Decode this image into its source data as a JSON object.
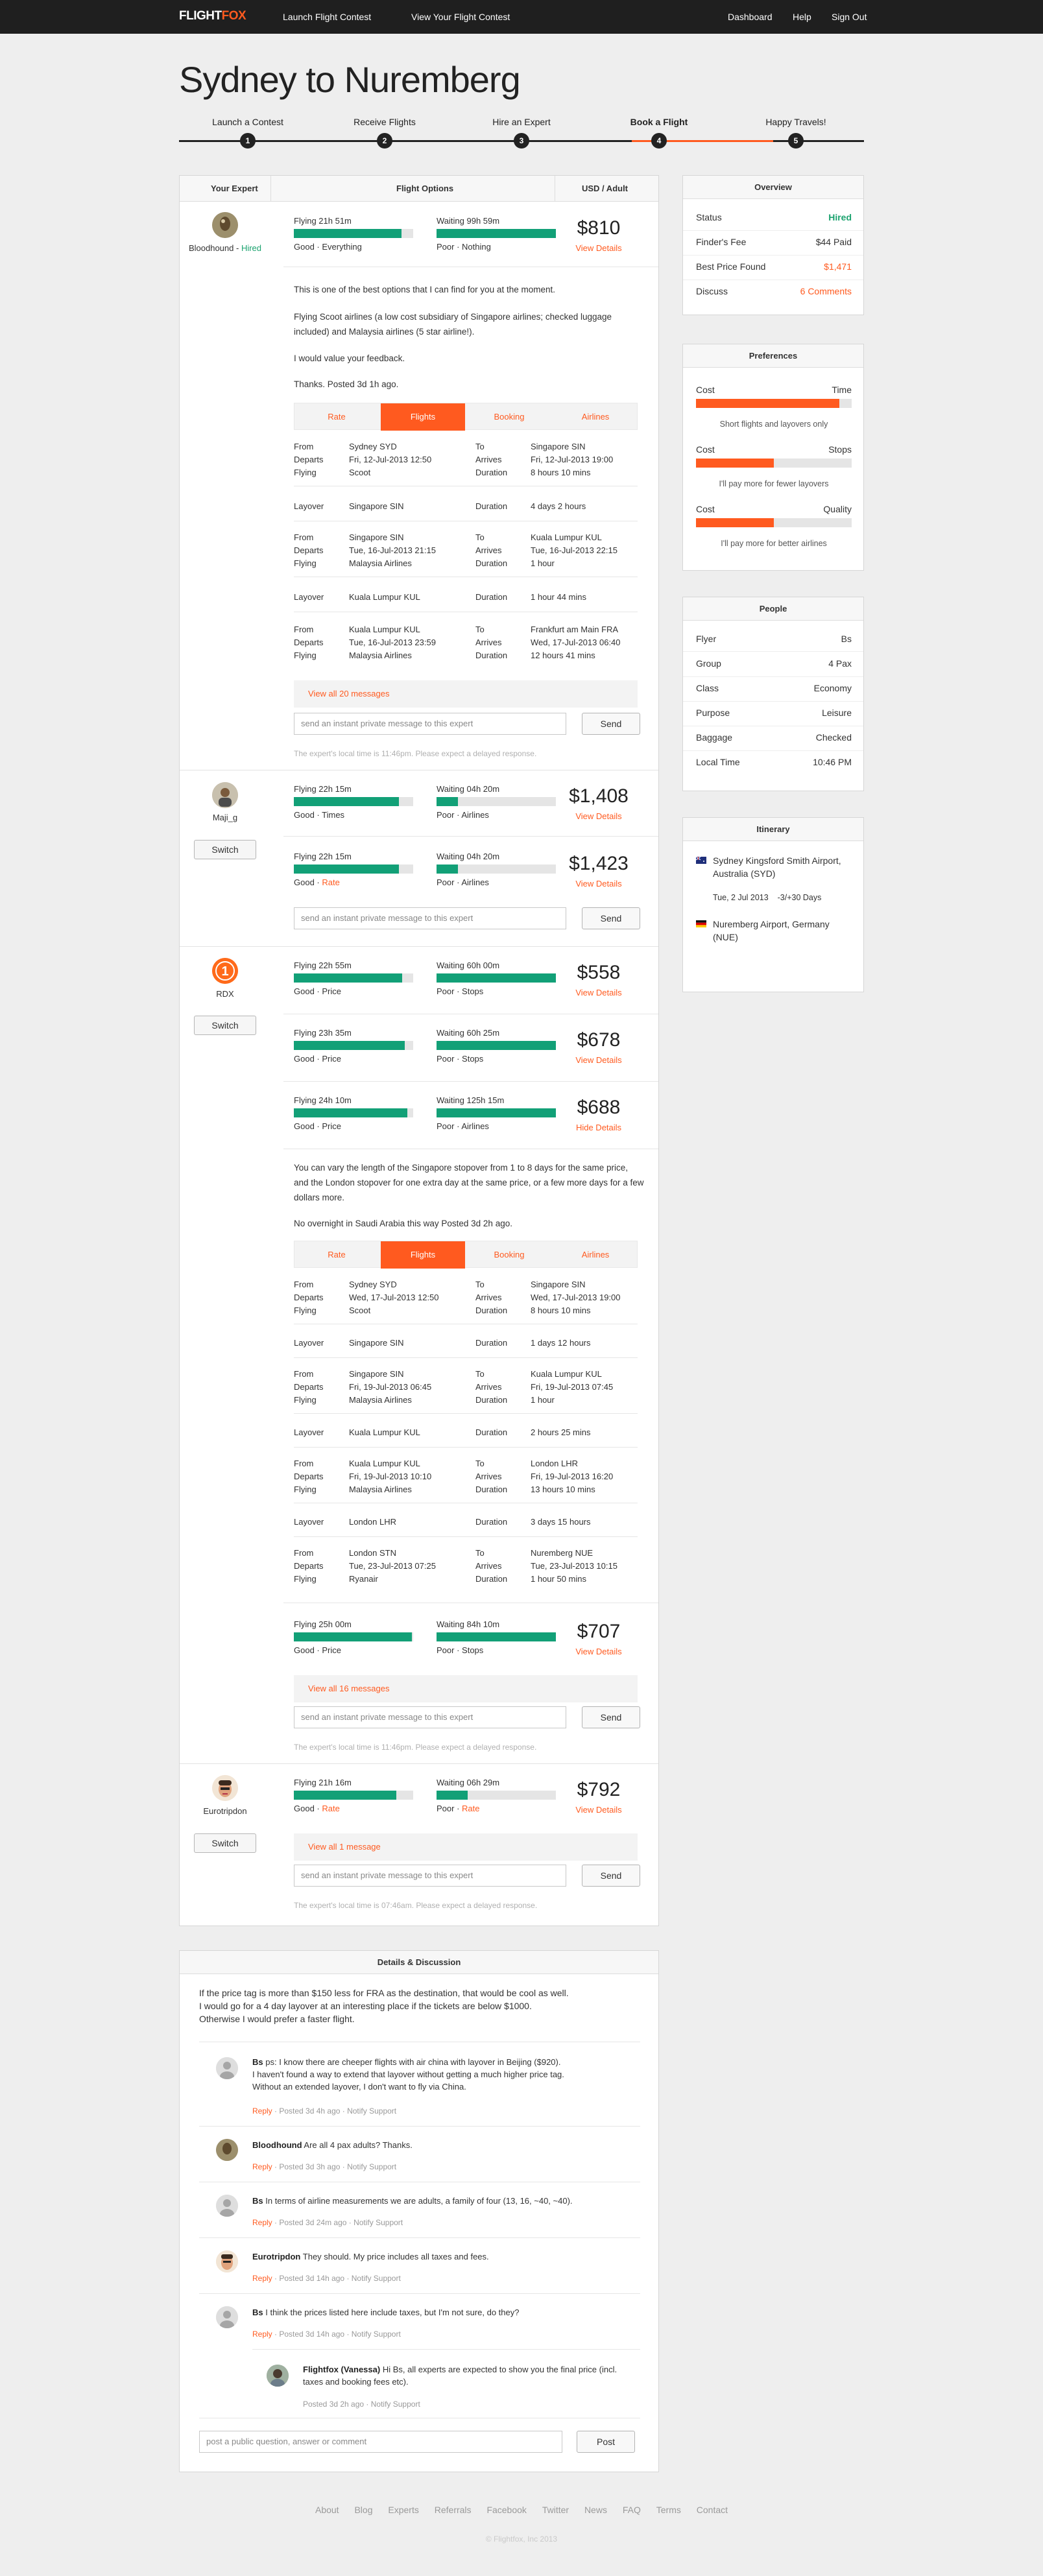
{
  "topbar": {
    "logo_a": "FLIGHT",
    "logo_b": "FOX",
    "nav_left": [
      "Launch Flight Contest",
      "View Your Flight Contest"
    ],
    "nav_right": [
      "Dashboard",
      "Help",
      "Sign Out"
    ]
  },
  "title": "Sydney to Nuremberg",
  "steps": [
    {
      "label": "Launch a Contest",
      "num": "1"
    },
    {
      "label": "Receive Flights",
      "num": "2"
    },
    {
      "label": "Hire an Expert",
      "num": "3"
    },
    {
      "label": "Book a Flight",
      "num": "4"
    },
    {
      "label": "Happy Travels!",
      "num": "5"
    }
  ],
  "main_header": {
    "expert": "Your Expert",
    "options": "Flight Options",
    "price": "USD / Adult"
  },
  "experts": {
    "e1": {
      "name": "Bloodhound",
      "sep": " - ",
      "status": "Hired",
      "options": [
        {
          "flying": "Flying 21h 51m",
          "flying_pct": 0.9,
          "waiting": "Waiting 99h 59m",
          "waiting_pct": 1.0,
          "fq": "Good",
          "fqv": "Everything",
          "wq": "Poor",
          "wqv": "Nothing",
          "price": "$810",
          "link": "View Details"
        }
      ],
      "notes": [
        "This is one of the best options that I can find for you at the moment.",
        "Flying Scoot airlines (a low cost subsidiary of Singapore airlines; checked luggage included) and Malaysia airlines (5 star airline!).",
        "I would value your feedback.",
        "Thanks. Posted 3d 1h ago."
      ],
      "tabs": [
        "Rate",
        "Flights",
        "Booking",
        "Airlines"
      ],
      "segments": [
        {
          "k1": "From",
          "v1": "Sydney SYD",
          "k2": "To",
          "v2": "Singapore SIN",
          "k3": "Departs",
          "v3": "Fri, 12-Jul-2013 12:50",
          "k4": "Arrives",
          "v4": "Fri, 12-Jul-2013 19:00",
          "k5": "Flying",
          "v5": "Scoot",
          "k6": "Duration",
          "v6": "8 hours 10 mins"
        },
        {
          "k1": "Layover",
          "v1": "Singapore SIN",
          "k2": "Duration",
          "v2": "4 days 2 hours"
        },
        {
          "k1": "From",
          "v1": "Singapore SIN",
          "k2": "To",
          "v2": "Kuala Lumpur KUL",
          "k3": "Departs",
          "v3": "Tue, 16-Jul-2013 21:15",
          "k4": "Arrives",
          "v4": "Tue, 16-Jul-2013 22:15",
          "k5": "Flying",
          "v5": "Malaysia Airlines",
          "k6": "Duration",
          "v6": "1 hour"
        },
        {
          "k1": "Layover",
          "v1": "Kuala Lumpur KUL",
          "k2": "Duration",
          "v2": "1 hour 44 mins"
        },
        {
          "k1": "From",
          "v1": "Kuala Lumpur KUL",
          "k2": "To",
          "v2": "Frankfurt am Main FRA",
          "k3": "Departs",
          "v3": "Tue, 16-Jul-2013 23:59",
          "k4": "Arrives",
          "v4": "Wed, 17-Jul-2013 06:40",
          "k5": "Flying",
          "v5": "Malaysia Airlines",
          "k6": "Duration",
          "v6": "12 hours 41 mins"
        }
      ],
      "view_all": "View all 20 messages",
      "input_placeholder": "send an instant private message to this expert",
      "send": "Send",
      "local_time": "The expert's local time is 11:46pm. Please expect a delayed response."
    },
    "e2": {
      "name": "Maji_g",
      "switch": "Switch",
      "options": [
        {
          "flying": "Flying 22h 15m",
          "flying_pct": 0.88,
          "waiting": "Waiting 04h 20m",
          "waiting_pct": 0.18,
          "fq": "Good",
          "fqv": "Times",
          "wq": "Poor",
          "wqv": "Airlines",
          "price": "$1,408",
          "link": "View Details"
        },
        {
          "flying": "Flying 22h 15m",
          "flying_pct": 0.88,
          "waiting": "Waiting 04h 20m",
          "waiting_pct": 0.18,
          "fq": "Good",
          "fqv": "Rate",
          "wq": "Poor",
          "wqv": "Airlines",
          "price": "$1,423",
          "link": "View Details"
        }
      ],
      "input_placeholder": "send an instant private message to this expert",
      "send": "Send"
    },
    "e3": {
      "name": "RDX",
      "badge": "1",
      "switch": "Switch",
      "options": [
        {
          "flying": "Flying 22h 55m",
          "flying_pct": 0.91,
          "waiting": "Waiting 60h 00m",
          "waiting_pct": 1.0,
          "fq": "Good",
          "fqv": "Price",
          "wq": "Poor",
          "wqv": "Stops",
          "price": "$558",
          "link": "View Details"
        },
        {
          "flying": "Flying 23h 35m",
          "flying_pct": 0.93,
          "waiting": "Waiting 60h 25m",
          "waiting_pct": 1.0,
          "fq": "Good",
          "fqv": "Price",
          "wq": "Poor",
          "wqv": "Stops",
          "price": "$678",
          "link": "View Details"
        },
        {
          "flying": "Flying 24h 10m",
          "flying_pct": 0.95,
          "waiting": "Waiting 125h 15m",
          "waiting_pct": 1.0,
          "fq": "Good",
          "fqv": "Price",
          "wq": "Poor",
          "wqv": "Airlines",
          "price": "$688",
          "link": "Hide Details"
        }
      ],
      "notes": [
        "You can vary the length of the Singapore stopover from 1 to 8 days for the same price, and the London stopover for one extra day at the same price, or a few more days for a few dollars more.",
        "No overnight in Saudi Arabia this way Posted 3d 2h ago."
      ],
      "tabs": [
        "Rate",
        "Flights",
        "Booking",
        "Airlines"
      ],
      "segments": [
        {
          "k1": "From",
          "v1": "Sydney SYD",
          "k2": "To",
          "v2": "Singapore SIN",
          "k3": "Departs",
          "v3": "Wed, 17-Jul-2013 12:50",
          "k4": "Arrives",
          "v4": "Wed, 17-Jul-2013 19:00",
          "k5": "Flying",
          "v5": "Scoot",
          "k6": "Duration",
          "v6": "8 hours 10 mins"
        },
        {
          "k1": "Layover",
          "v1": "Singapore SIN",
          "k2": "Duration",
          "v2": "1 days 12 hours"
        },
        {
          "k1": "From",
          "v1": "Singapore SIN",
          "k2": "To",
          "v2": "Kuala Lumpur KUL",
          "k3": "Departs",
          "v3": "Fri, 19-Jul-2013 06:45",
          "k4": "Arrives",
          "v4": "Fri, 19-Jul-2013 07:45",
          "k5": "Flying",
          "v5": "Malaysia Airlines",
          "k6": "Duration",
          "v6": "1 hour"
        },
        {
          "k1": "Layover",
          "v1": "Kuala Lumpur KUL",
          "k2": "Duration",
          "v2": "2 hours 25 mins"
        },
        {
          "k1": "From",
          "v1": "Kuala Lumpur KUL",
          "k2": "To",
          "v2": "London LHR",
          "k3": "Departs",
          "v3": "Fri, 19-Jul-2013 10:10",
          "k4": "Arrives",
          "v4": "Fri, 19-Jul-2013 16:20",
          "k5": "Flying",
          "v5": "Malaysia Airlines",
          "k6": "Duration",
          "v6": "13 hours 10 mins"
        },
        {
          "k1": "Layover",
          "v1": "London LHR",
          "k2": "Duration",
          "v2": "3 days 15 hours"
        },
        {
          "k1": "From",
          "v1": "London STN",
          "k2": "To",
          "v2": "Nuremberg NUE",
          "k3": "Departs",
          "v3": "Tue, 23-Jul-2013 07:25",
          "k4": "Arrives",
          "v4": "Tue, 23-Jul-2013 10:15",
          "k5": "Flying",
          "v5": "Ryanair",
          "k6": "Duration",
          "v6": "1 hour 50 mins"
        }
      ],
      "option4": {
        "flying": "Flying 25h 00m",
        "flying_pct": 0.99,
        "waiting": "Waiting 84h 10m",
        "waiting_pct": 1.0,
        "fq": "Good",
        "fqv": "Price",
        "wq": "Poor",
        "wqv": "Stops",
        "price": "$707",
        "link": "View Details"
      },
      "view_all": "View all 16 messages",
      "input_placeholder": "send an instant private message to this expert",
      "send": "Send",
      "local_time": "The expert's local time is 11:46pm. Please expect a delayed response."
    },
    "e4": {
      "name": "Eurotripdon",
      "switch": "Switch",
      "options": [
        {
          "flying": "Flying 21h 16m",
          "flying_pct": 0.86,
          "waiting": "Waiting 06h 29m",
          "waiting_pct": 0.26,
          "fq": "Good",
          "fqv": "Rate",
          "wq": "Poor",
          "wqv": "Rate",
          "price": "$792",
          "link": "View Details"
        }
      ],
      "view_all": "View all 1 message",
      "input_placeholder": "send an instant private message to this expert",
      "send": "Send",
      "local_time": "The expert's local time is 07:46am. Please expect a delayed response."
    }
  },
  "overview": {
    "title": "Overview",
    "rows": [
      {
        "k": "Status",
        "v": "Hired"
      },
      {
        "k": "Finder's Fee",
        "v": "$44 Paid"
      },
      {
        "k": "Best Price Found",
        "v": "$1,471"
      },
      {
        "k": "Discuss",
        "v": "6 Comments"
      }
    ]
  },
  "preferences": {
    "title": "Preferences",
    "items": [
      {
        "left": "Cost",
        "right": "Time",
        "fill": 0.92,
        "note": "Short flights and layovers only"
      },
      {
        "left": "Cost",
        "right": "Stops",
        "fill": 0.5,
        "note": "I'll pay more for fewer layovers"
      },
      {
        "left": "Cost",
        "right": "Quality",
        "fill": 0.5,
        "note": "I'll pay more for better airlines"
      }
    ]
  },
  "people": {
    "title": "People",
    "rows": [
      {
        "k": "Flyer",
        "v": "Bs"
      },
      {
        "k": "Group",
        "v": "4 Pax"
      },
      {
        "k": "Class",
        "v": "Economy"
      },
      {
        "k": "Purpose",
        "v": "Leisure"
      },
      {
        "k": "Baggage",
        "v": "Checked"
      },
      {
        "k": "Local Time",
        "v": "10:46 PM"
      }
    ]
  },
  "itinerary": {
    "title": "Itinerary",
    "from": "Sydney Kingsford Smith Airport, Australia (SYD)",
    "date": "Tue, 2 Jul 2013",
    "flex": "-3/+30 Days",
    "to": "Nuremberg Airport, Germany (NUE)"
  },
  "discussion": {
    "title": "Details & Discussion",
    "intro": [
      "If the price tag is more than $150 less for FRA as the destination, that would be cool as well.",
      "I would go for a 4 day layover at an interesting place if the tickets are below $1000.",
      "Otherwise I would prefer a faster flight."
    ],
    "reply": "Reply",
    "comments": [
      {
        "author": "Bs",
        "lines": [
          " ps: I know there are cheeper flights with air china with layover in Beijing ($920).",
          "I haven't found a way to extend that layover without getting a much higher price tag.",
          "Without an extended layover, I don't want to fly via China."
        ],
        "meta": " · Posted 3d 4h ago · Notify Support"
      },
      {
        "author": "Bloodhound",
        "lines": [
          " Are all 4 pax adults? Thanks."
        ],
        "meta": " · Posted 3d 3h ago · Notify Support"
      },
      {
        "author": "Bs",
        "lines": [
          " In terms of airline measurements we are adults, a family of four (13, 16, ~40, ~40)."
        ],
        "meta": " · Posted 3d 24m ago · Notify Support"
      },
      {
        "author": "Eurotripdon",
        "lines": [
          " They should. My price includes all taxes and fees."
        ],
        "meta": " · Posted 3d 14h ago · Notify Support"
      },
      {
        "author": "Bs",
        "lines": [
          " I think the prices listed here include taxes, but I'm not sure, do they?"
        ],
        "meta": " · Posted 3d 14h ago · Notify Support"
      },
      {
        "author": "Flightfox (Vanessa)",
        "lines": [
          " Hi Bs, all experts are expected to show you the final price (incl.",
          "taxes and booking fees etc)."
        ],
        "meta": "Posted 3d 2h ago · Notify Support"
      }
    ],
    "input_placeholder": "post a public question, answer or comment",
    "post": "Post"
  },
  "footer": {
    "links": [
      "About",
      "Blog",
      "Experts",
      "Referrals",
      "Facebook",
      "Twitter",
      "News",
      "FAQ",
      "Terms",
      "Contact"
    ],
    "copyright": "© Flightfox, Inc 2013"
  }
}
